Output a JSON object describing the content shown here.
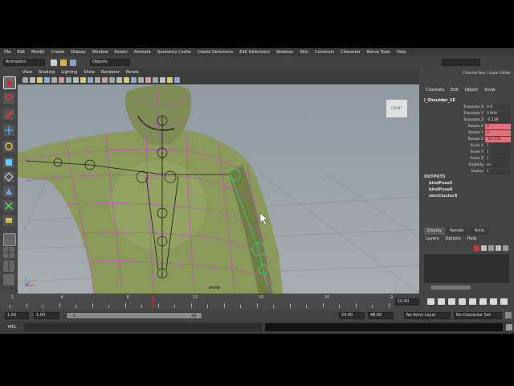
{
  "menubar": {
    "items": [
      "File",
      "Edit",
      "Modify",
      "Create",
      "Display",
      "Window",
      "Assets",
      "Animate",
      "Geometry Cache",
      "Create Deformers",
      "Edit Deformers",
      "Skeleton",
      "Skin",
      "Constrain",
      "Character",
      "Bonus Tools",
      "Help"
    ]
  },
  "statusline": {
    "menu_set": "Animation",
    "selection_mask": "Objects"
  },
  "panel_menu": [
    "View",
    "Shading",
    "Lighting",
    "Show",
    "Renderer",
    "Panels"
  ],
  "viewport": {
    "camera_label": "persp",
    "viewcube_label": "FRONT"
  },
  "channel_box": {
    "title": "Channel Box / Layer Editor",
    "menus": [
      "Channels",
      "Edit",
      "Object",
      "Show"
    ],
    "object_name": "l_Shoulder_1E",
    "channels": [
      {
        "name": "Translate X",
        "value": "0.9",
        "keyed": false
      },
      {
        "name": "Translate Y",
        "value": "0.004",
        "keyed": false
      },
      {
        "name": "Translate Z",
        "value": "-0.126",
        "keyed": false
      },
      {
        "name": "Rotate X",
        "value": "0",
        "keyed": true
      },
      {
        "name": "Rotate Y",
        "value": "0",
        "keyed": true
      },
      {
        "name": "Rotate Z",
        "value": "-61.776",
        "keyed": true
      },
      {
        "name": "Scale X",
        "value": "1",
        "keyed": false
      },
      {
        "name": "Scale Y",
        "value": "1",
        "keyed": false
      },
      {
        "name": "Scale Z",
        "value": "1",
        "keyed": false
      },
      {
        "name": "Visibility",
        "value": "on",
        "keyed": false
      },
      {
        "name": "Radius",
        "value": "1",
        "keyed": false
      }
    ],
    "outputs_title": "OUTPUTS",
    "outputs": [
      "bindPose5",
      "bindPose4",
      "skinCluster8"
    ]
  },
  "layer_editor": {
    "tabs": [
      "Display",
      "Render",
      "Anim"
    ],
    "menus": [
      "Layers",
      "Options",
      "Help"
    ]
  },
  "timeline": {
    "ticks": [
      "1",
      "4",
      "8",
      "12",
      "16",
      "20",
      "24"
    ],
    "current_frame": "10.00",
    "range_start": "1.00",
    "range_start_inner": "1.00",
    "range_slider_start": "1",
    "range_slider_end": "24",
    "range_end_inner": "24.00",
    "range_end": "48.00",
    "anim_layer": "No Anim Layer",
    "character_set": "No Character Set"
  },
  "commandline": {
    "label": "MEL"
  },
  "colors": {
    "ui_gray": "#444444",
    "viewport_bg": "#9aa3ab",
    "skin": "#8a9a5a",
    "wire": "#d040d0",
    "bone": "#1a1a1a",
    "key_red": "#e0707a",
    "playhead": "#cc2222"
  }
}
